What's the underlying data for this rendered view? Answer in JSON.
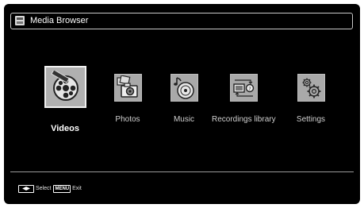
{
  "header": {
    "title": "Media Browser",
    "icon": "media-browser-icon"
  },
  "menu": {
    "items": [
      {
        "id": "videos",
        "label": "Videos",
        "icon": "film-reel-icon",
        "selected": true
      },
      {
        "id": "photos",
        "label": "Photos",
        "icon": "camera-photos-icon",
        "selected": false
      },
      {
        "id": "music",
        "label": "Music",
        "icon": "music-disc-icon",
        "selected": false
      },
      {
        "id": "recordings",
        "label": "Recordings library",
        "icon": "recordings-tv-icon",
        "selected": false
      },
      {
        "id": "settings",
        "label": "Settings",
        "icon": "gears-icon",
        "selected": false
      }
    ]
  },
  "footer": {
    "arrows_key": "◀▶",
    "select_label": "Select",
    "menu_key": "MENU",
    "exit_label": "Exit"
  },
  "colors": {
    "background": "#000000",
    "tile": "#a9a9a9",
    "text": "#ffffff"
  }
}
